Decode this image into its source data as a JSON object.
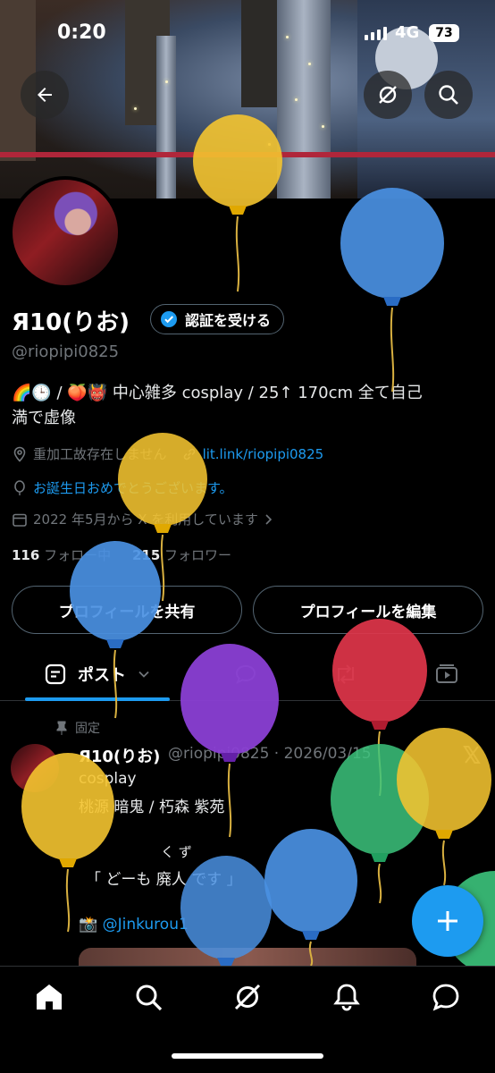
{
  "status_bar": {
    "time": "0:20",
    "network": "4G",
    "battery": "73"
  },
  "profile": {
    "display_name": "Я10(りお)",
    "verify_label": "認証を受ける",
    "handle": "@riopipi0825",
    "bio_prefix": "🌈🕒 / 🍑👹 中心雑多 cosplay / 25↑ 170cm 全て自己",
    "bio_line2": "満で虚像",
    "location": "重加工故存在しません",
    "link": "lit.link/riopipi0825",
    "birthday": "お誕生日おめでとうございます。",
    "joined": "2022 年5月から X を利用しています",
    "following_count": "116",
    "following_label": "フォロー中",
    "followers_count": "215",
    "followers_label": "フォロワー"
  },
  "buttons": {
    "share": "プロフィールを共有",
    "edit": "プロフィールを編集"
  },
  "tabs": {
    "posts": "ポスト"
  },
  "post": {
    "pinned_label": "固定",
    "author": "Я10(りお)",
    "meta": "@riopipi0825 · 2026/03/15",
    "line1": "cosplay",
    "line2": "桃源 暗鬼 / 朽森 紫苑",
    "ruby": "く ず",
    "line3": "「 どーも 廃人 です 」",
    "mention_emoji": "📸",
    "mention": "@Jinkurou1"
  },
  "colors": {
    "accent": "#1d9bf0",
    "background": "#000000",
    "muted": "#71767b"
  },
  "icons": [
    "back-arrow-icon",
    "grok-icon",
    "search-icon",
    "verified-badge-icon",
    "location-icon",
    "link-icon",
    "balloon-icon",
    "calendar-icon",
    "chevron-right-icon",
    "posts-tab-icon",
    "chevron-down-icon",
    "replies-icon",
    "reposts-icon",
    "media-icon",
    "pin-icon",
    "x-logo-icon",
    "plus-icon",
    "home-icon",
    "grok-nav-icon",
    "bell-icon",
    "messages-icon"
  ]
}
